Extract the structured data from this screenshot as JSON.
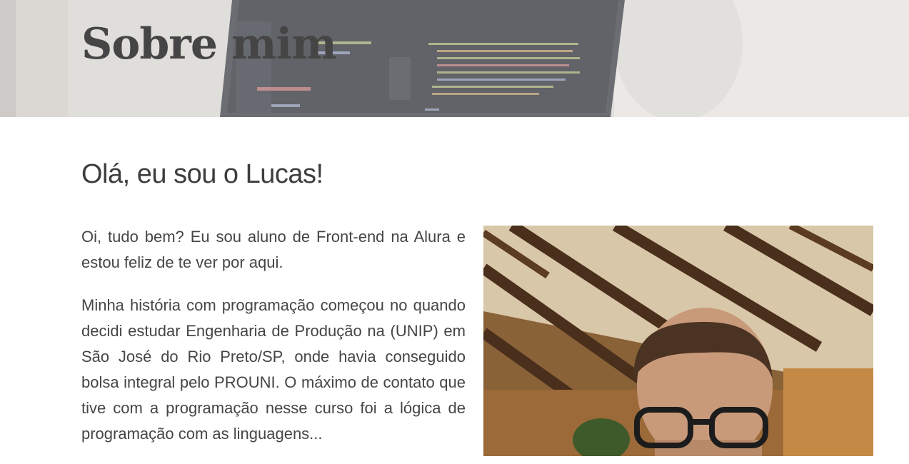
{
  "hero": {
    "title": "Sobre mim"
  },
  "main": {
    "greeting": "Olá, eu sou o Lucas!",
    "paragraphs": [
      "Oi, tudo bem? Eu sou aluno de Front-end na Alura e estou feliz de te ver por aqui.",
      "Minha história com programação começou no quando decidi estudar Engenharia de Produção na (UNIP) em São José do Rio Preto/SP, onde havia conseguido bolsa integral pelo PROUNI. O máximo de contato que tive com a programação nesse curso foi a lógica de programação com as linguagens..."
    ]
  },
  "colors": {
    "heading": "#454545",
    "text": "#454545",
    "background": "#ffffff"
  },
  "icons": {
    "hero_image": "laptop-code-photo",
    "profile_photo": "person-photo"
  }
}
